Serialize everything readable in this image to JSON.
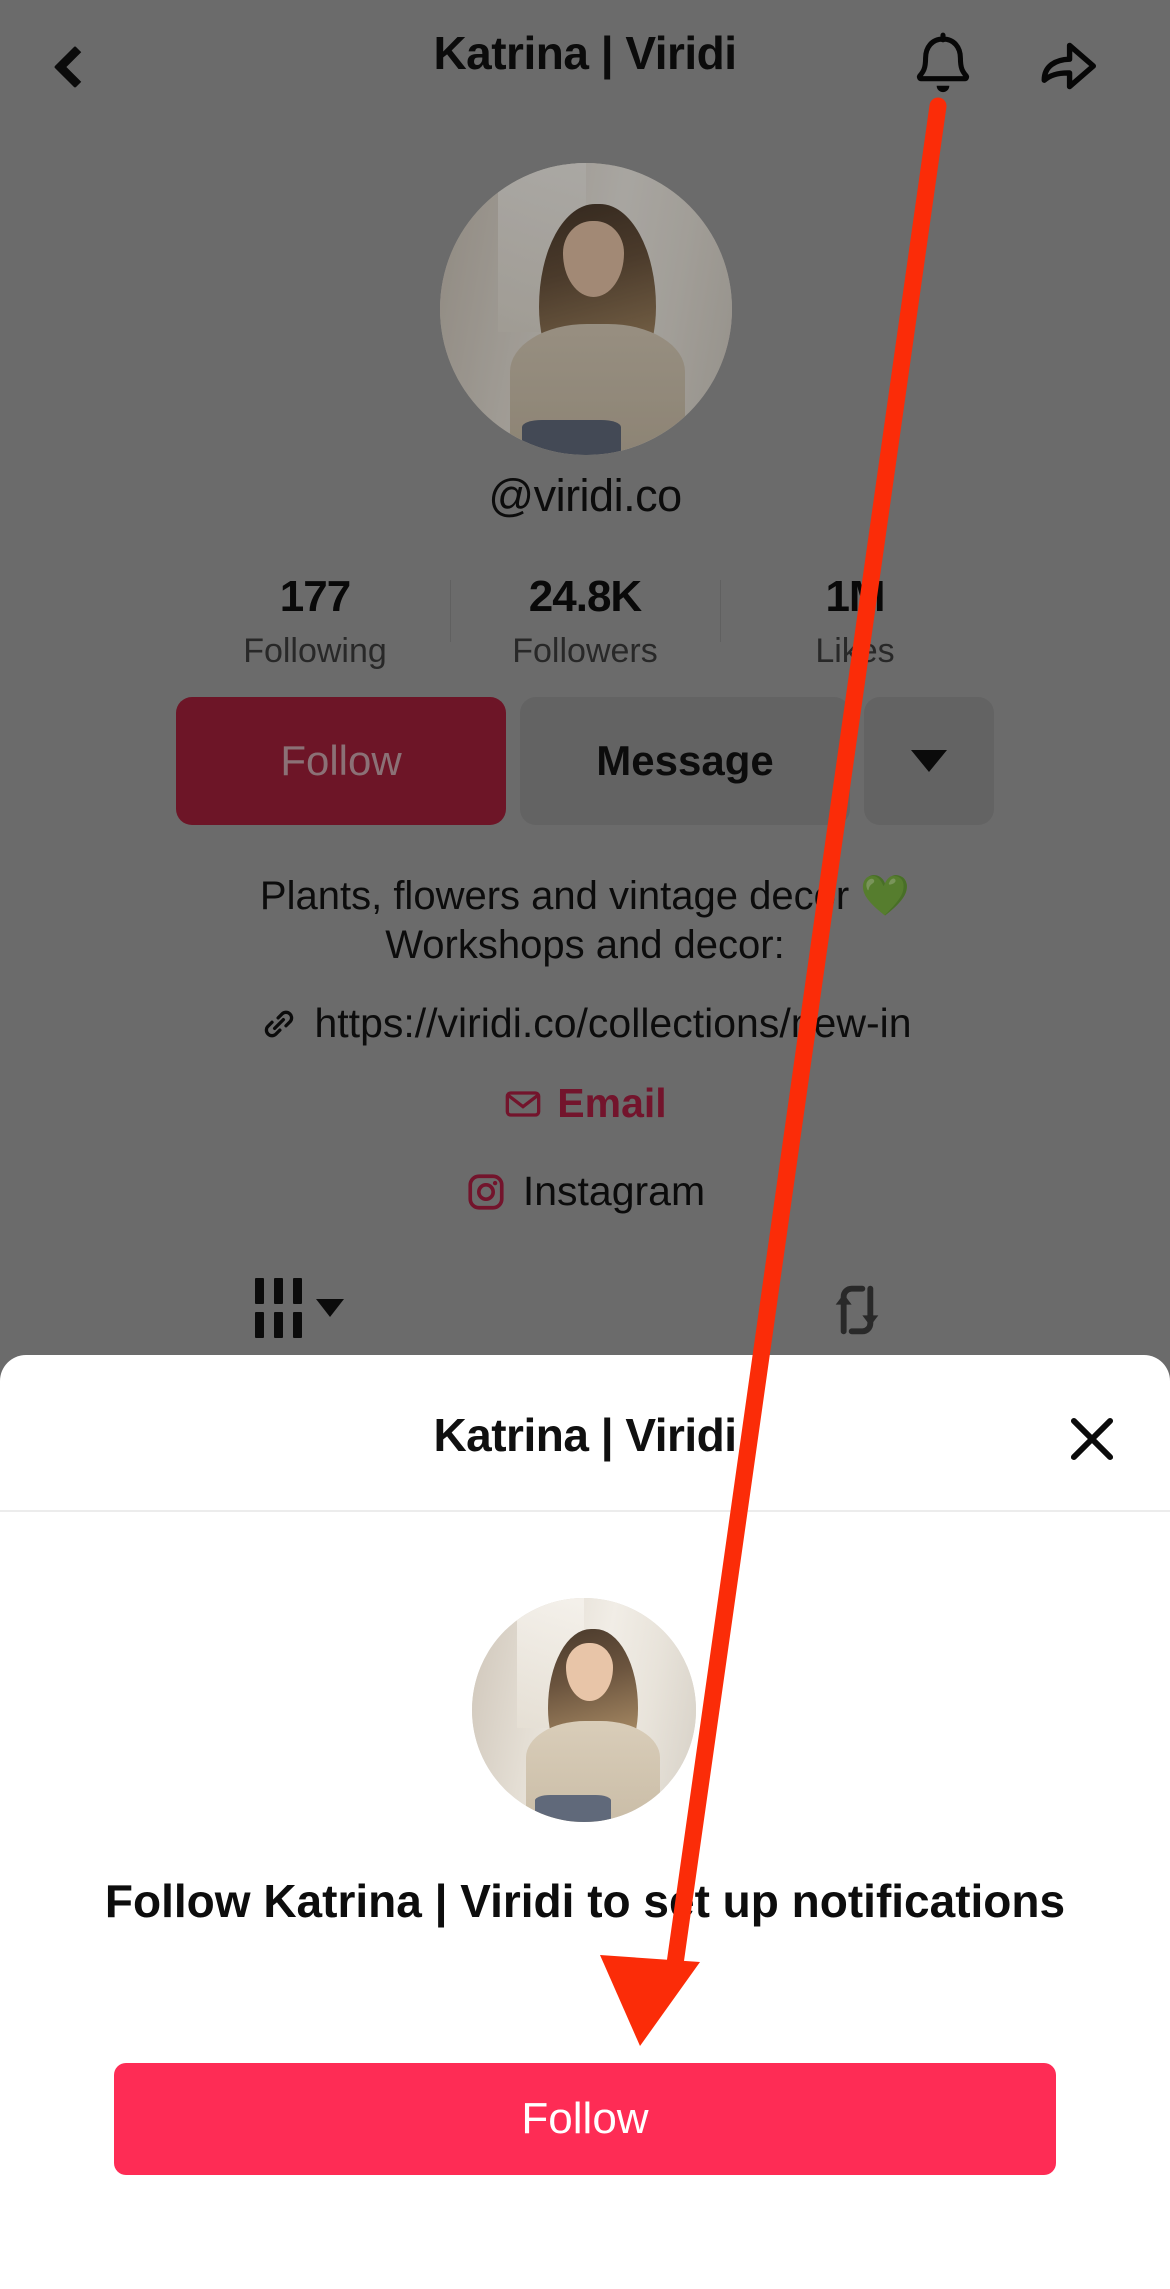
{
  "header": {
    "title": "Katrina | Viridi",
    "back_icon": "chevron-left-icon",
    "bell_icon": "bell-icon",
    "share_icon": "share-arrow-icon"
  },
  "profile": {
    "handle": "@viridi.co",
    "avatar_alt": "profile-photo",
    "stats": [
      {
        "value": "177",
        "label": "Following"
      },
      {
        "value": "24.8K",
        "label": "Followers"
      },
      {
        "value": "1M",
        "label": "Likes"
      }
    ],
    "actions": {
      "follow_label": "Follow",
      "message_label": "Message",
      "more_icon": "chevron-down-icon"
    },
    "bio": {
      "line1": "Plants, flowers and vintage decor 💚",
      "line2": "Workshops and decor:"
    },
    "link": {
      "icon": "link-icon",
      "url": "https://viridi.co/collections/new-in"
    },
    "email": {
      "icon": "envelope-icon",
      "label": "Email"
    },
    "instagram": {
      "icon": "instagram-icon",
      "label": "Instagram"
    },
    "tabs": {
      "grid_icon": "grid-icon",
      "grid_caret_icon": "caret-down-icon",
      "repost_icon": "repost-icon"
    }
  },
  "modal": {
    "title": "Katrina | Viridi",
    "close_icon": "close-icon",
    "avatar_alt": "modal-profile-photo",
    "prompt": "Follow Katrina | Viridi to set up notifications",
    "follow_label": "Follow"
  },
  "annotation": {
    "arrow_color": "#FB2C08",
    "arrow_from": "bell-icon",
    "arrow_to": "modal-follow-button"
  },
  "colors": {
    "accent_pink": "#FE2C55",
    "dim_follow": "#9C1F38",
    "overlay_gray": "#7D7D7D",
    "email_red": "#A51E3F"
  }
}
